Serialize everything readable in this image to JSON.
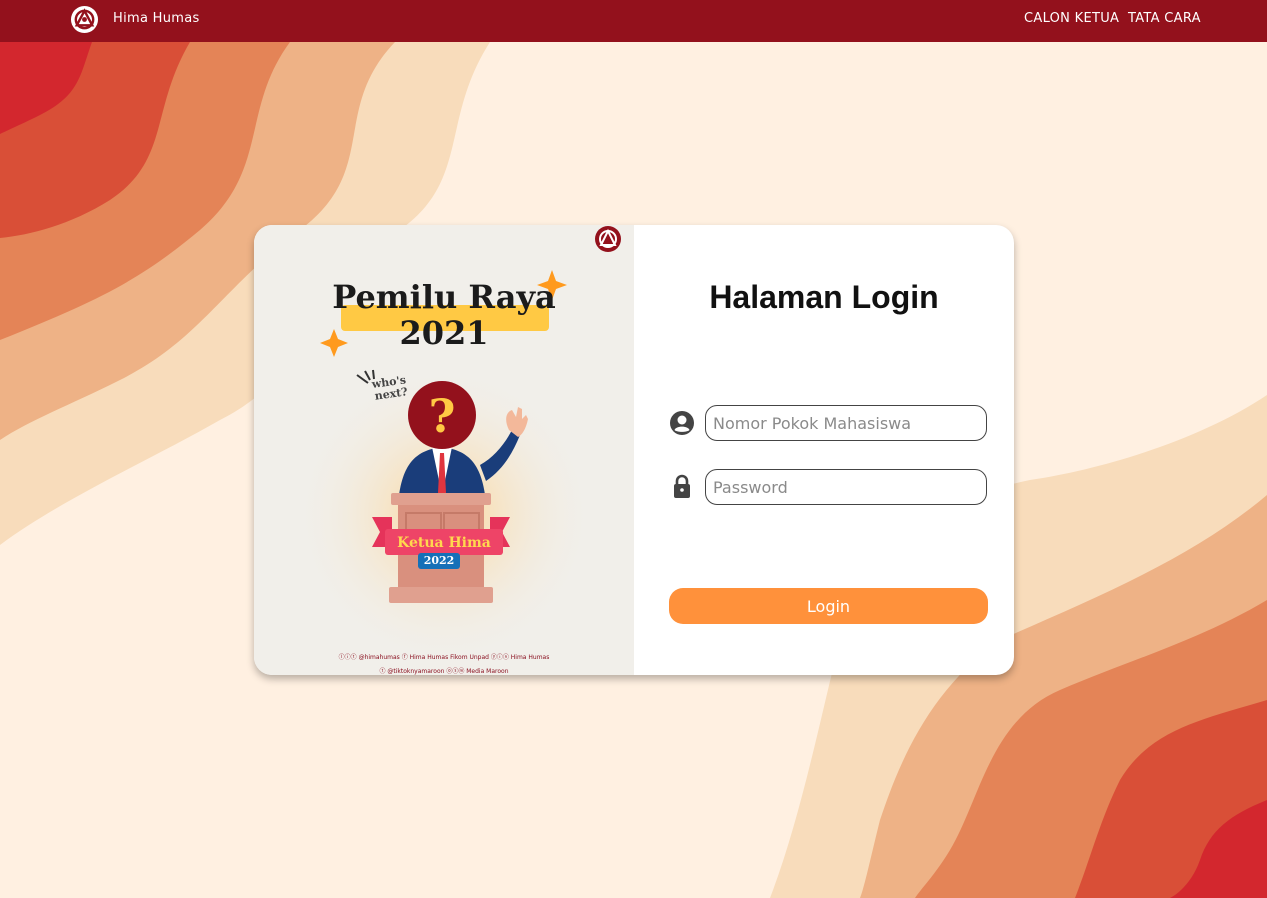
{
  "navbar": {
    "brand": "Hima Humas",
    "links": [
      "CALON KETUA",
      "TATA CARA"
    ]
  },
  "poster": {
    "title_line1": "Pemilu Raya",
    "title_line2": "2021",
    "callout": "who's next?",
    "ribbon": "Ketua Hima",
    "year_badge": "2022",
    "socials_line1": "ⓛⓘⓣ @himahumas   ⓕ Hima Humas Fikom Unpad   ⓨⓘⓝ Hima Humas",
    "socials_line2": "ⓣ @tiktoknyamaroon   ⓞⓢⓜ Media Maroon"
  },
  "login": {
    "title": "Halaman Login",
    "npm_placeholder": "Nomor Pokok Mahasiswa",
    "password_placeholder": "Password",
    "button": "Login"
  },
  "colors": {
    "navbar": "#93111c",
    "accent": "#ff913b",
    "background": "#fff0e1"
  },
  "icons": [
    "hima-logo-icon",
    "user-circle-icon",
    "lock-icon"
  ]
}
